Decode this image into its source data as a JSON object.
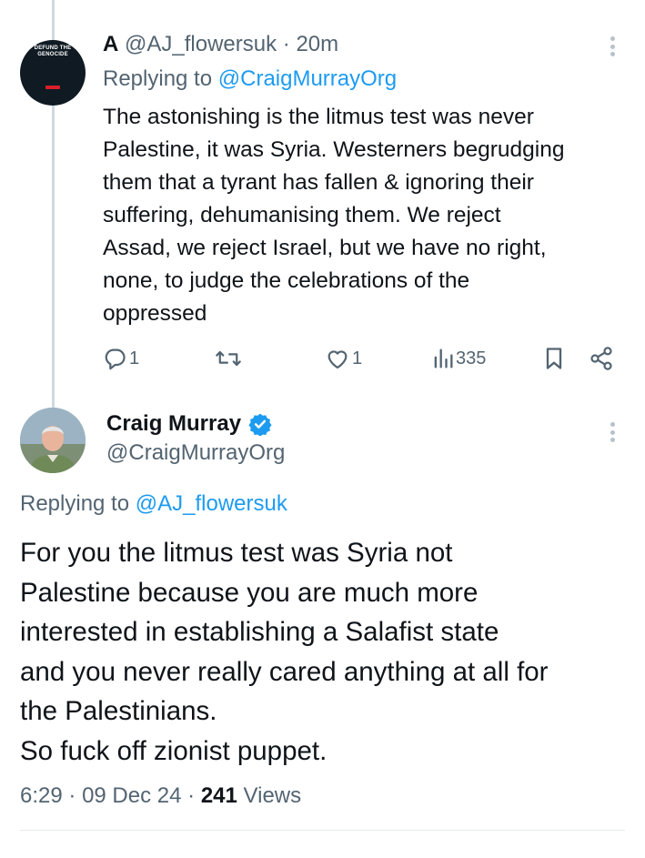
{
  "reply": {
    "avatar_lines": [
      "DEFUND THE",
      "GENOCIDE"
    ],
    "display_name": "A",
    "handle": "@AJ_flowersuk",
    "separator": "·",
    "time": "20m",
    "replying_prefix": "Replying to",
    "replying_to": "@CraigMurrayOrg",
    "text": "The astonishing is the litmus test was never\nPalestine, it was Syria. Westerners begrudging\nthem that a tyrant has fallen & ignoring their\nsuffering, dehumanising them. We reject\nAssad, we reject Israel, but we have no right,\nnone, to judge the celebrations of the\noppressed",
    "actions": {
      "reply_count": "1",
      "retweet_count": "",
      "like_count": "1",
      "views_count": "335"
    }
  },
  "main": {
    "display_name": "Craig Murray",
    "handle": "@CraigMurrayOrg",
    "replying_prefix": "Replying to",
    "replying_to": "@AJ_flowersuk",
    "text": "For you the litmus test was Syria not\nPalestine because you are much more\ninterested in establishing a Salafist state\nand you never really cared anything at all for\nthe Palestinians.\nSo fuck off zionist puppet.",
    "time": "6:29",
    "date": "09 Dec 24",
    "separator": "·",
    "views_count": "241",
    "views_label": "Views"
  },
  "icons": {
    "reply": "reply-icon",
    "retweet": "retweet-icon",
    "like": "heart-icon",
    "views": "views-chart-icon",
    "bookmark": "bookmark-icon",
    "share": "share-icon",
    "more": "more-vertical-icon",
    "verified": "verified-badge-icon"
  },
  "colors": {
    "link": "#1d9bf0",
    "secondary_text": "#536471",
    "primary_text": "#0f1419",
    "verified": "#1d9bf0"
  }
}
